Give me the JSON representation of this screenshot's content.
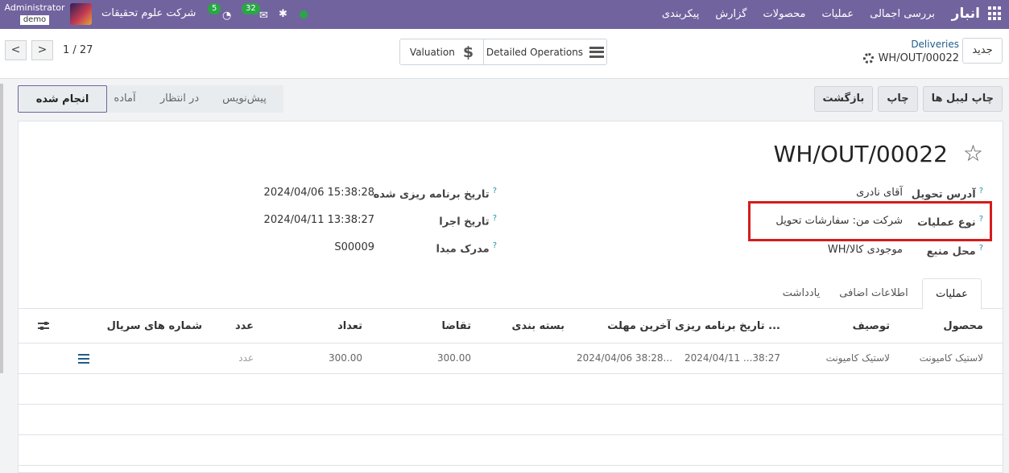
{
  "navbar": {
    "brand": "انبار",
    "menu": [
      "بررسی اجمالی",
      "عملیات",
      "محصولات",
      "گزارش",
      "پیکربندی"
    ],
    "company": "شرکت علوم تحقیقات",
    "user": "Administrator",
    "database": "demo",
    "activity_count": "5",
    "message_count": "32"
  },
  "control_panel": {
    "new_button": "جدید",
    "breadcrumb_parent": "Deliveries",
    "breadcrumb_current": "WH/OUT/00022",
    "smart_buttons": {
      "valuation": "Valuation",
      "detailed_operations": "Detailed Operations"
    },
    "pager": "1 / 27",
    "pager_prev": "<",
    "pager_next": ">"
  },
  "actions": {
    "print_labels": "چاپ لیبل ها",
    "print": "چاپ",
    "return": "بازگشت"
  },
  "statusbar": {
    "draft": "پیش‌نویس",
    "waiting": "در انتظار",
    "ready": "آماده",
    "done": "انجام شده"
  },
  "record": {
    "name": "WH/OUT/00022",
    "help_mark": "?",
    "delivery_address_label": "آدرس تحویل",
    "delivery_address": "آقای نادری",
    "operation_type_label": "نوع عملیات",
    "operation_type": "شرکت من: سفارشات تحویل",
    "source_location_label": "محل منبع",
    "source_location": "WH/موجودی کالا",
    "scheduled_date_label": "تاریخ برنامه ریزی شده",
    "scheduled_date": "2024/04/06 15:38:28",
    "effective_date_label": "تاریخ اجرا",
    "effective_date": "2024/04/11 13:38:27",
    "origin_label": "مدرک مبدا",
    "origin": "S00009"
  },
  "tabs": {
    "operations": "عملیات",
    "additional_info": "اطلاعات اضافی",
    "note": "یادداشت"
  },
  "moves_table": {
    "columns": {
      "product": "محصول",
      "description": "توصیف",
      "date_scheduled": "تاریخ برنامه ریزی ...",
      "deadline": "آخرین مهلت",
      "packaging": "بسته بندی",
      "demand": "تقاضا",
      "quantity": "تعداد",
      "uom": "عدد",
      "serials": "شماره های سریال"
    },
    "rows": [
      {
        "product": "لاستیک کامیونت",
        "description": "لاستیک کامیونت",
        "date_scheduled": "2024/04/11 ...38:27",
        "deadline": "2024/04/06 38:28...",
        "packaging": "",
        "demand": "300.00",
        "quantity": "300.00",
        "uom": "عدد"
      }
    ]
  },
  "colors": {
    "navbar": "#71639e",
    "highlight": "#d51b1b",
    "link": "#1f5c8b",
    "online": "#28a745"
  }
}
